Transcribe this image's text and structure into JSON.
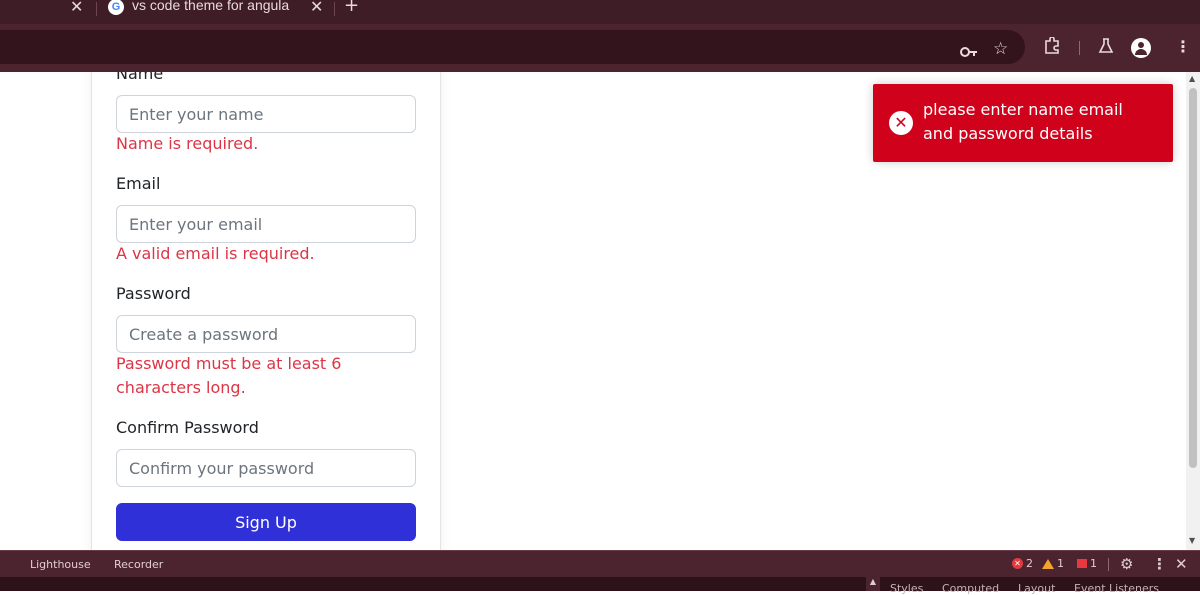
{
  "browser": {
    "tab_title": "vs code theme for angula",
    "tab_close_glyph": "✕",
    "new_tab_glyph": "+",
    "favicon_letter": "G"
  },
  "toolbar_icons": [
    "key-icon",
    "star-icon",
    "extensions-icon",
    "labs-icon",
    "profile-icon",
    "menu-icon"
  ],
  "form": {
    "name_label": "Name",
    "name_placeholder": "Enter your name",
    "name_error": "Name is required.",
    "email_label": "Email",
    "email_placeholder": "Enter your email",
    "email_error": "A valid email is required.",
    "password_label": "Password",
    "password_placeholder": "Create a password",
    "password_error": "Password must be at least 6 characters long.",
    "confirm_label": "Confirm Password",
    "confirm_placeholder": "Confirm your password",
    "submit_label": "Sign Up"
  },
  "toast": {
    "message": "please enter name email and password details",
    "icon": "error-icon",
    "color": "#d0021b"
  },
  "devtools": {
    "tabs": [
      "Lighthouse",
      "Recorder"
    ],
    "errors": "2",
    "warnings": "1",
    "issues": "1",
    "sub_tabs": [
      "Styles",
      "Computed",
      "Layout",
      "Event Listeners"
    ]
  }
}
